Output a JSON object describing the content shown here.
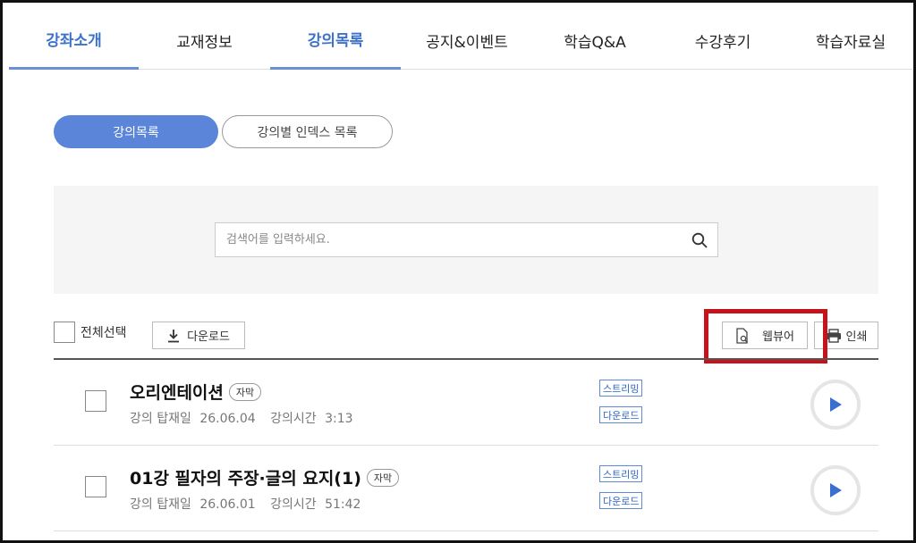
{
  "tabs": [
    {
      "label": "강좌소개",
      "active": true
    },
    {
      "label": "교재정보",
      "active": false
    },
    {
      "label": "강의목록",
      "active": true
    },
    {
      "label": "공지&이벤트",
      "active": false
    },
    {
      "label": "학습Q&A",
      "active": false
    },
    {
      "label": "수강후기",
      "active": false
    },
    {
      "label": "학습자료실",
      "active": false
    }
  ],
  "view_toggle": {
    "lecture_list": "강의목록",
    "index_list": "강의별 인덱스 목록"
  },
  "search": {
    "placeholder": "검색어를 입력하세요.",
    "value": ""
  },
  "toolbar": {
    "select_all": "전체선택",
    "download": "다운로드",
    "web_viewer": "웹뷰어",
    "print": "인쇄"
  },
  "lectures": [
    {
      "title": "오리엔테이션",
      "badge": "자막",
      "upload_label": "강의 탑재일",
      "upload_date": "26.06.04",
      "duration_label": "강의시간",
      "duration": "3:13",
      "stream_label": "스트리밍",
      "download_label": "다운로드"
    },
    {
      "title": "01강 필자의 주장·글의 요지(1)",
      "badge": "자막",
      "upload_label": "강의 탑재일",
      "upload_date": "26.06.01",
      "duration_label": "강의시간",
      "duration": "51:42",
      "stream_label": "스트리밍",
      "download_label": "다운로드"
    }
  ],
  "colors": {
    "accent": "#5b85d8",
    "tab_active_text": "#3d72cc",
    "highlight_box": "#c8121b",
    "tag_blue": "#2f66c8",
    "play_blue": "#3a6fd0"
  }
}
